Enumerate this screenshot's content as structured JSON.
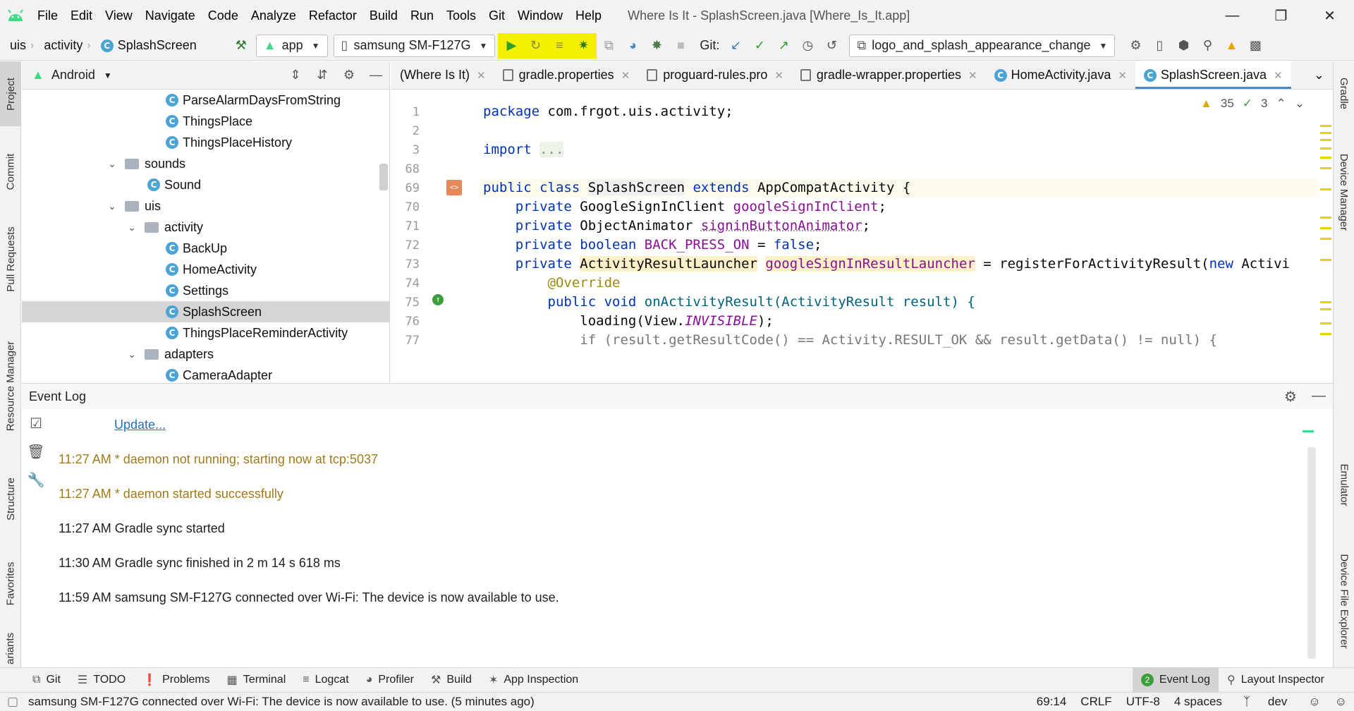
{
  "menubar": {
    "items": [
      "File",
      "Edit",
      "View",
      "Navigate",
      "Code",
      "Analyze",
      "Refactor",
      "Build",
      "Run",
      "Tools",
      "Git",
      "Window",
      "Help"
    ],
    "window_title": "Where Is It - SplashScreen.java [Where_Is_It.app]"
  },
  "navbar": {
    "crumbs": [
      "uis",
      "activity",
      "SplashScreen"
    ],
    "run_config": "app",
    "device": "samsung SM-F127G",
    "git_label": "Git:",
    "branch": "logo_and_splash_appearance_change"
  },
  "left_stripe": {
    "tabs": [
      "Project",
      "Commit",
      "Pull Requests",
      "Resource Manager",
      "Structure",
      "Favorites",
      "ariants"
    ]
  },
  "right_stripe": {
    "tabs": [
      "Gradle",
      "Device Manager",
      "Emulator",
      "Device File Explorer"
    ]
  },
  "project": {
    "view_selector": "Android",
    "tree": [
      {
        "label": "ParseAlarmDaysFromString",
        "type": "class"
      },
      {
        "label": "ThingsPlace",
        "type": "class"
      },
      {
        "label": "ThingsPlaceHistory",
        "type": "class"
      },
      {
        "label": "sounds",
        "type": "folder"
      },
      {
        "label": "Sound",
        "type": "class"
      },
      {
        "label": "uis",
        "type": "folder"
      },
      {
        "label": "activity",
        "type": "folder"
      },
      {
        "label": "BackUp",
        "type": "class"
      },
      {
        "label": "HomeActivity",
        "type": "class"
      },
      {
        "label": "Settings",
        "type": "class"
      },
      {
        "label": "SplashScreen",
        "type": "class",
        "selected": true
      },
      {
        "label": "ThingsPlaceReminderActivity",
        "type": "class"
      },
      {
        "label": "adapters",
        "type": "folder"
      },
      {
        "label": "CameraAdapter",
        "type": "class"
      }
    ]
  },
  "editor": {
    "tabs": [
      {
        "label": "(Where Is It)"
      },
      {
        "label": "gradle.properties"
      },
      {
        "label": "proguard-rules.pro"
      },
      {
        "label": "gradle-wrapper.properties"
      },
      {
        "label": "HomeActivity.java"
      },
      {
        "label": "SplashScreen.java",
        "active": true
      }
    ],
    "warnings": "35",
    "weak_warnings": "3",
    "line_numbers": [
      "1",
      "2",
      "3",
      "68",
      "69",
      "70",
      "71",
      "72",
      "73",
      "74",
      "75",
      "76",
      "77"
    ],
    "code": {
      "l1_kw": "package",
      "l1_rest": " com.frgot.uis.activity;",
      "l3_kw": "import",
      "l3_fold": "...",
      "l69_kw": "public class",
      "l69_name": "SplashScreen",
      "l69_kw2": " extends",
      "l69_rest": " AppCompatActivity {",
      "l70_kw": "private",
      "l70_type": " GoogleSignInClient ",
      "l70_fld": "googleSignInClient",
      "l70_end": ";",
      "l71_kw": "private",
      "l71_type": " ObjectAnimator ",
      "l71_fld": "signinButtonAnimator",
      "l71_end": ";",
      "l72_kw": "private boolean",
      "l72_fld": " BACK_PRESS_ON",
      "l72_eq": " = ",
      "l72_val": "false",
      "l72_end": ";",
      "l73_kw": "private",
      "l73_type": "ActivityResultLauncher",
      "l73_fld": "googleSignInResultLauncher",
      "l73_rest": " = registerForActivityResult(",
      "l73_new": "new",
      "l73_tail": " Activi",
      "l74_ann": "@Override",
      "l75_kw": "public void",
      "l75_rest": " onActivityResult(ActivityResult result) {",
      "l76_rest": "loading(View.",
      "l76_const": "INVISIBLE",
      "l76_end": ");",
      "l77_text": "if (result.getResultCode() == Activity.RESULT_OK && result.getData() != null) {"
    }
  },
  "event_log": {
    "title": "Event Log",
    "update_link": "Update...",
    "entries": [
      {
        "time": "11:27 AM",
        "text": "* daemon not running; starting now at tcp:5037",
        "level": "warn"
      },
      {
        "time": "11:27 AM",
        "text": "* daemon started successfully",
        "level": "warn"
      },
      {
        "time": "11:27 AM",
        "text": "Gradle sync started",
        "level": "info"
      },
      {
        "time": "11:30 AM",
        "text": "Gradle sync finished in 2 m 14 s 618 ms",
        "level": "info"
      },
      {
        "time": "11:59 AM",
        "text": "samsung SM-F127G connected over Wi-Fi: The device is now available to use.",
        "level": "info"
      }
    ]
  },
  "bottom_tabs": {
    "left": [
      "Git",
      "TODO",
      "Problems",
      "Terminal",
      "Logcat",
      "Profiler",
      "Build",
      "App Inspection"
    ],
    "event_log": "Event Log",
    "event_log_badge": "2",
    "layout_inspector": "Layout Inspector"
  },
  "status": {
    "message": "samsung SM-F127G connected over Wi-Fi: The device is now available to use. (5 minutes ago)",
    "position": "69:14",
    "line_sep": "CRLF",
    "encoding": "UTF-8",
    "indent": "4 spaces",
    "branch": "dev"
  },
  "colors": {
    "accent": "#4a88c7",
    "run_highlight": "#f5f000",
    "android_green": "#3ddc84",
    "warning_text": "#a07a1c",
    "link": "#2470b3"
  }
}
